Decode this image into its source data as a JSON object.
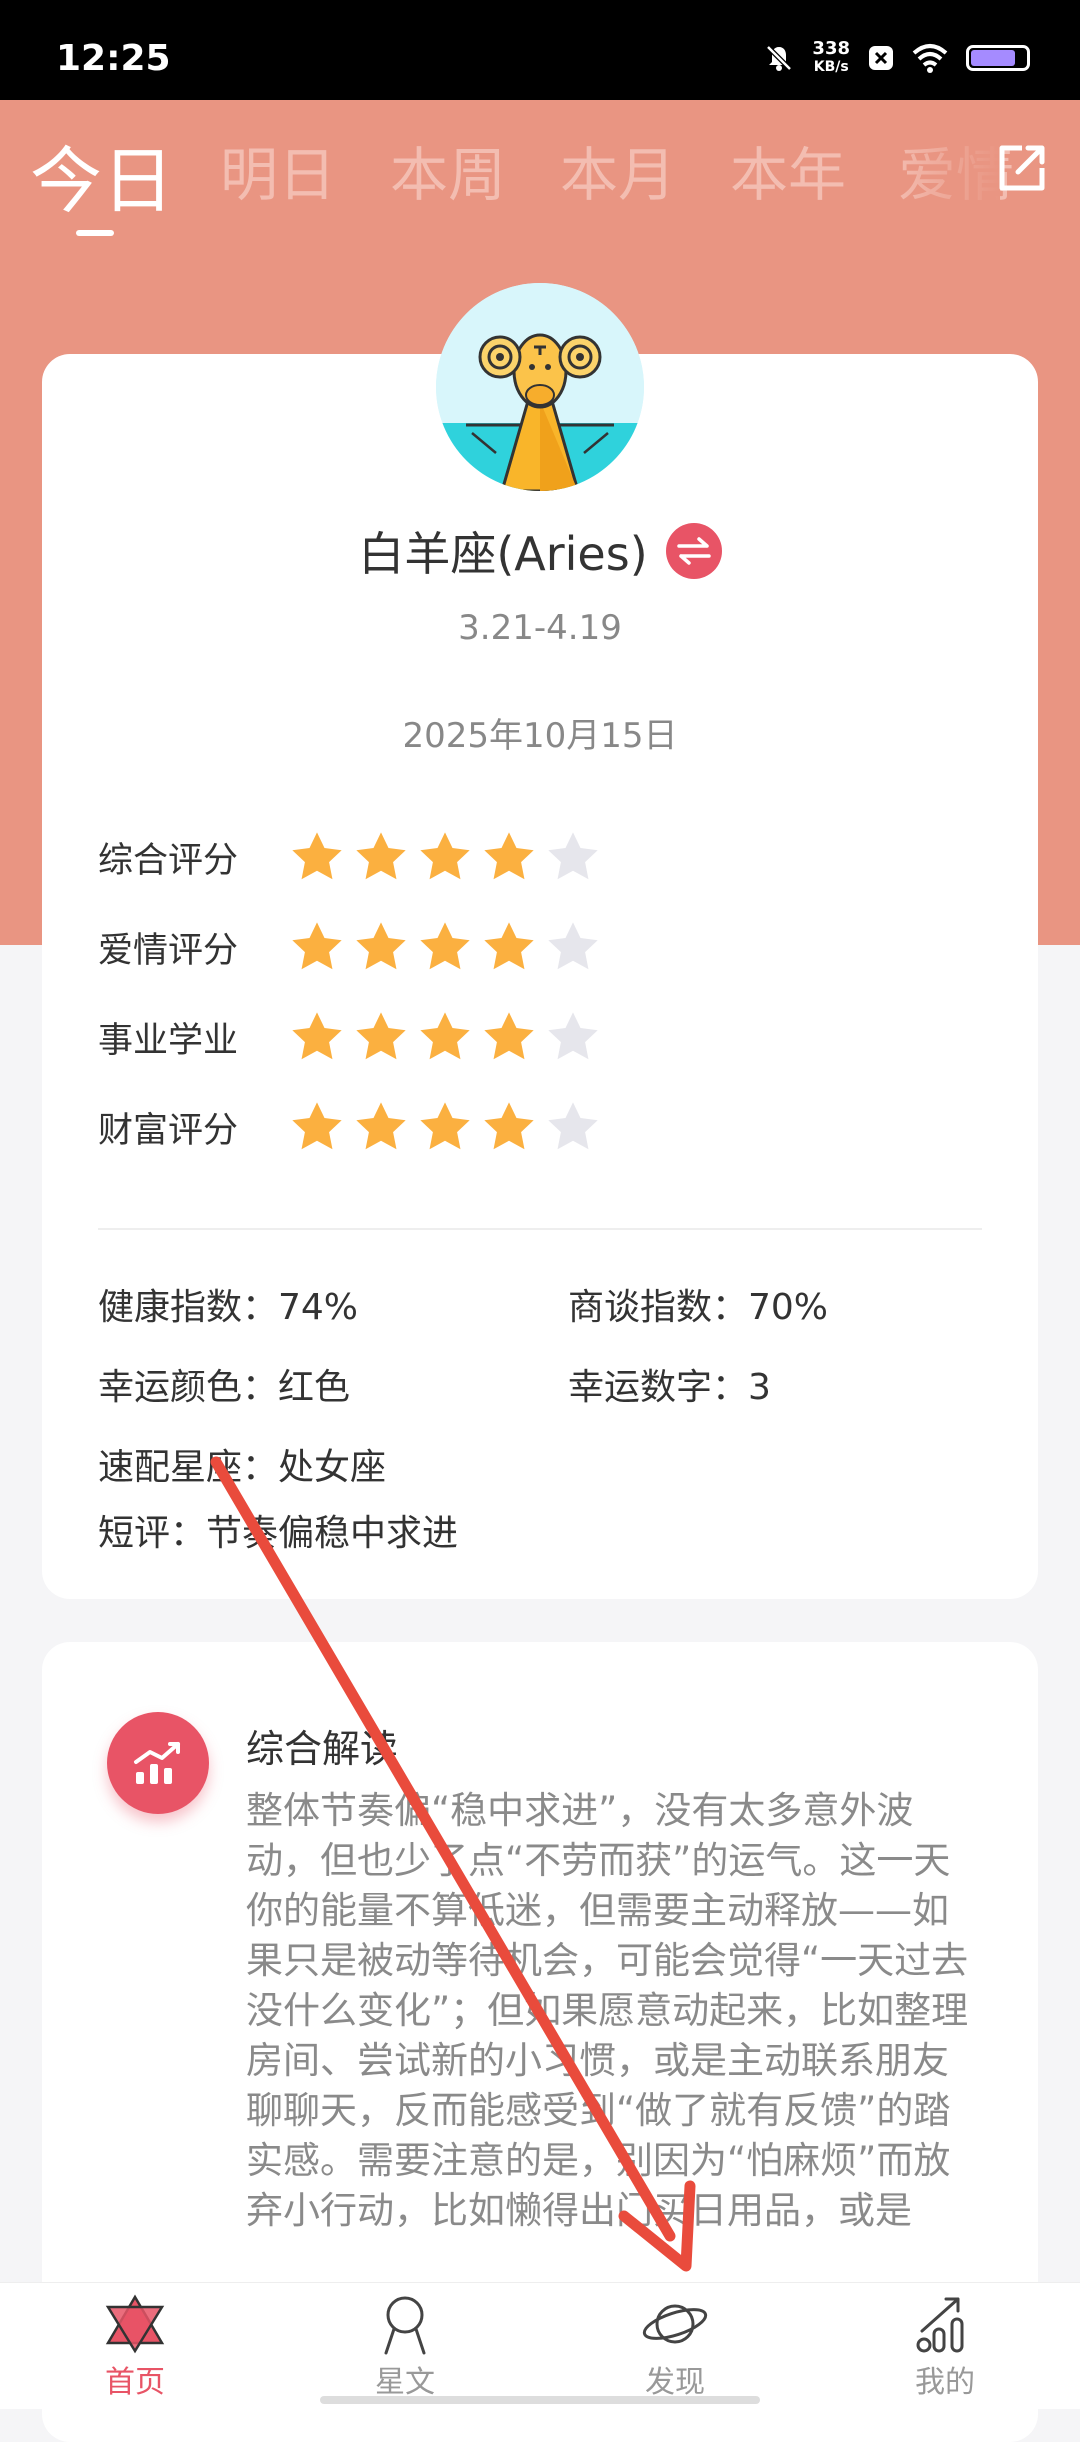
{
  "status_bar": {
    "time": "12:25",
    "net_speed_value": "338",
    "net_speed_unit": "KB/s"
  },
  "tabs": [
    {
      "label": "今日",
      "active": true
    },
    {
      "label": "明日"
    },
    {
      "label": "本周"
    },
    {
      "label": "本月"
    },
    {
      "label": "本年"
    },
    {
      "label": "爱情"
    }
  ],
  "sign": {
    "name": "白羊座(Aries)",
    "range": "3.21-4.19"
  },
  "date": "2025年10月15日",
  "ratings": [
    {
      "label": "综合评分",
      "stars": 4,
      "max": 5
    },
    {
      "label": "爱情评分",
      "stars": 4,
      "max": 5
    },
    {
      "label": "事业学业",
      "stars": 4,
      "max": 5
    },
    {
      "label": "财富评分",
      "stars": 4,
      "max": 5
    }
  ],
  "info": {
    "health": "健康指数：74%",
    "negotiation": "商谈指数：70%",
    "lucky_color": "幸运颜色：红色",
    "lucky_number": "幸运数字：3",
    "match": "速配星座：处女座",
    "comment": "短评：节奏偏稳中求进"
  },
  "reading": {
    "title": "综合解读",
    "text": "整体节奏偏“稳中求进”，没有太多意外波动，但也少了点“不劳而获”的运气。这一天你的能量不算低迷，但需要主动释放——如果只是被动等待机会，可能会觉得“一天过去没什么变化”；但如果愿意动起来，比如整理房间、尝试新的小习惯，或是主动联系朋友聊聊天，反而能感受到“做了就有反馈”的踏实感。需要注意的是，别因为“怕麻烦”而放弃小行动，比如懒得出门买日用品，或是"
  },
  "nav": [
    {
      "label": "首页",
      "icon": "hexagram-icon",
      "active": true
    },
    {
      "label": "星文",
      "icon": "person-icon"
    },
    {
      "label": "发现",
      "icon": "planet-icon"
    },
    {
      "label": "我的",
      "icon": "stats-icon"
    }
  ],
  "colors": {
    "header": "#e99582",
    "accent": "#e85466",
    "star": "#fbb040",
    "star_empty": "#e6e6ec"
  },
  "icons": {
    "share": "share-icon",
    "switch": "switch-icon",
    "reading": "trend-chart-icon",
    "avatar": "aries-ram-icon"
  }
}
